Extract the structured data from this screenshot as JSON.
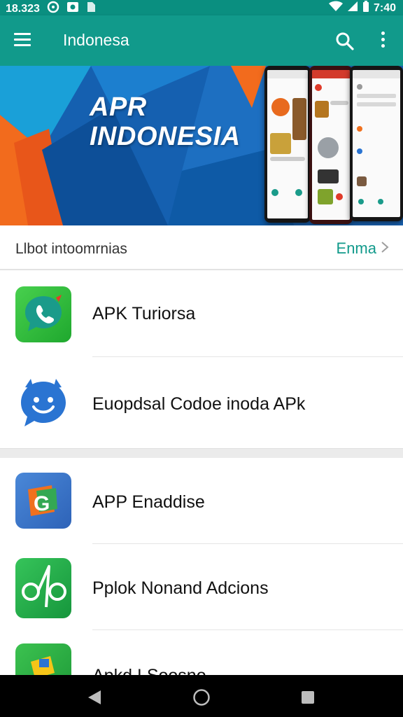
{
  "status_bar": {
    "time_left": "18.323",
    "time_right": "7:40"
  },
  "app_bar": {
    "title": "Indonesa",
    "menu_icon": "hamburger-menu-icon",
    "search_icon": "search-icon",
    "more_icon": "more-vert-icon"
  },
  "banner": {
    "line1": "APR",
    "line2": "INDONESIA"
  },
  "section": {
    "title": "Llbot intoomrnias",
    "more_label": "Enma"
  },
  "items": [
    {
      "label": "APK Turiorsa",
      "icon": "phone-chat-app-icon",
      "color": "#2ebd3a"
    },
    {
      "label": "Euopdsal Codoe inoda APk",
      "icon": "smiley-chat-app-icon",
      "color": "#2a74d2"
    },
    {
      "label": "APP Enaddise",
      "icon": "g-logo-app-icon",
      "color": "#3b78c9"
    },
    {
      "label": "Pplok Nonand Adcions",
      "icon": "scissors-app-icon",
      "color": "#1ea84a"
    },
    {
      "label": "Apkd I Soosno",
      "icon": "folder-app-icon",
      "color": "#25a63f"
    }
  ],
  "colors": {
    "primary": "#119a8b",
    "status_bar": "#0a8f80",
    "banner_blue": "#1767b8",
    "banner_orange": "#f0701e"
  }
}
